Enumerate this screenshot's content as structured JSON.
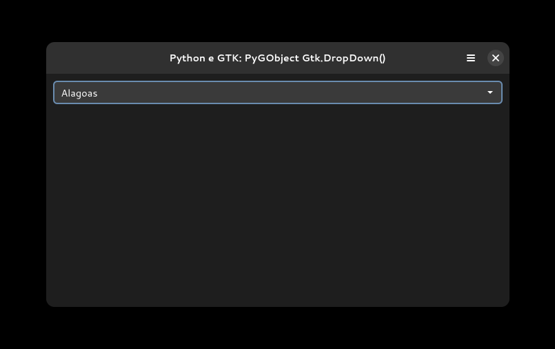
{
  "window": {
    "title": "Python e GTK: PyGObject Gtk.DropDown()"
  },
  "dropdown": {
    "selected": "Alagoas"
  }
}
